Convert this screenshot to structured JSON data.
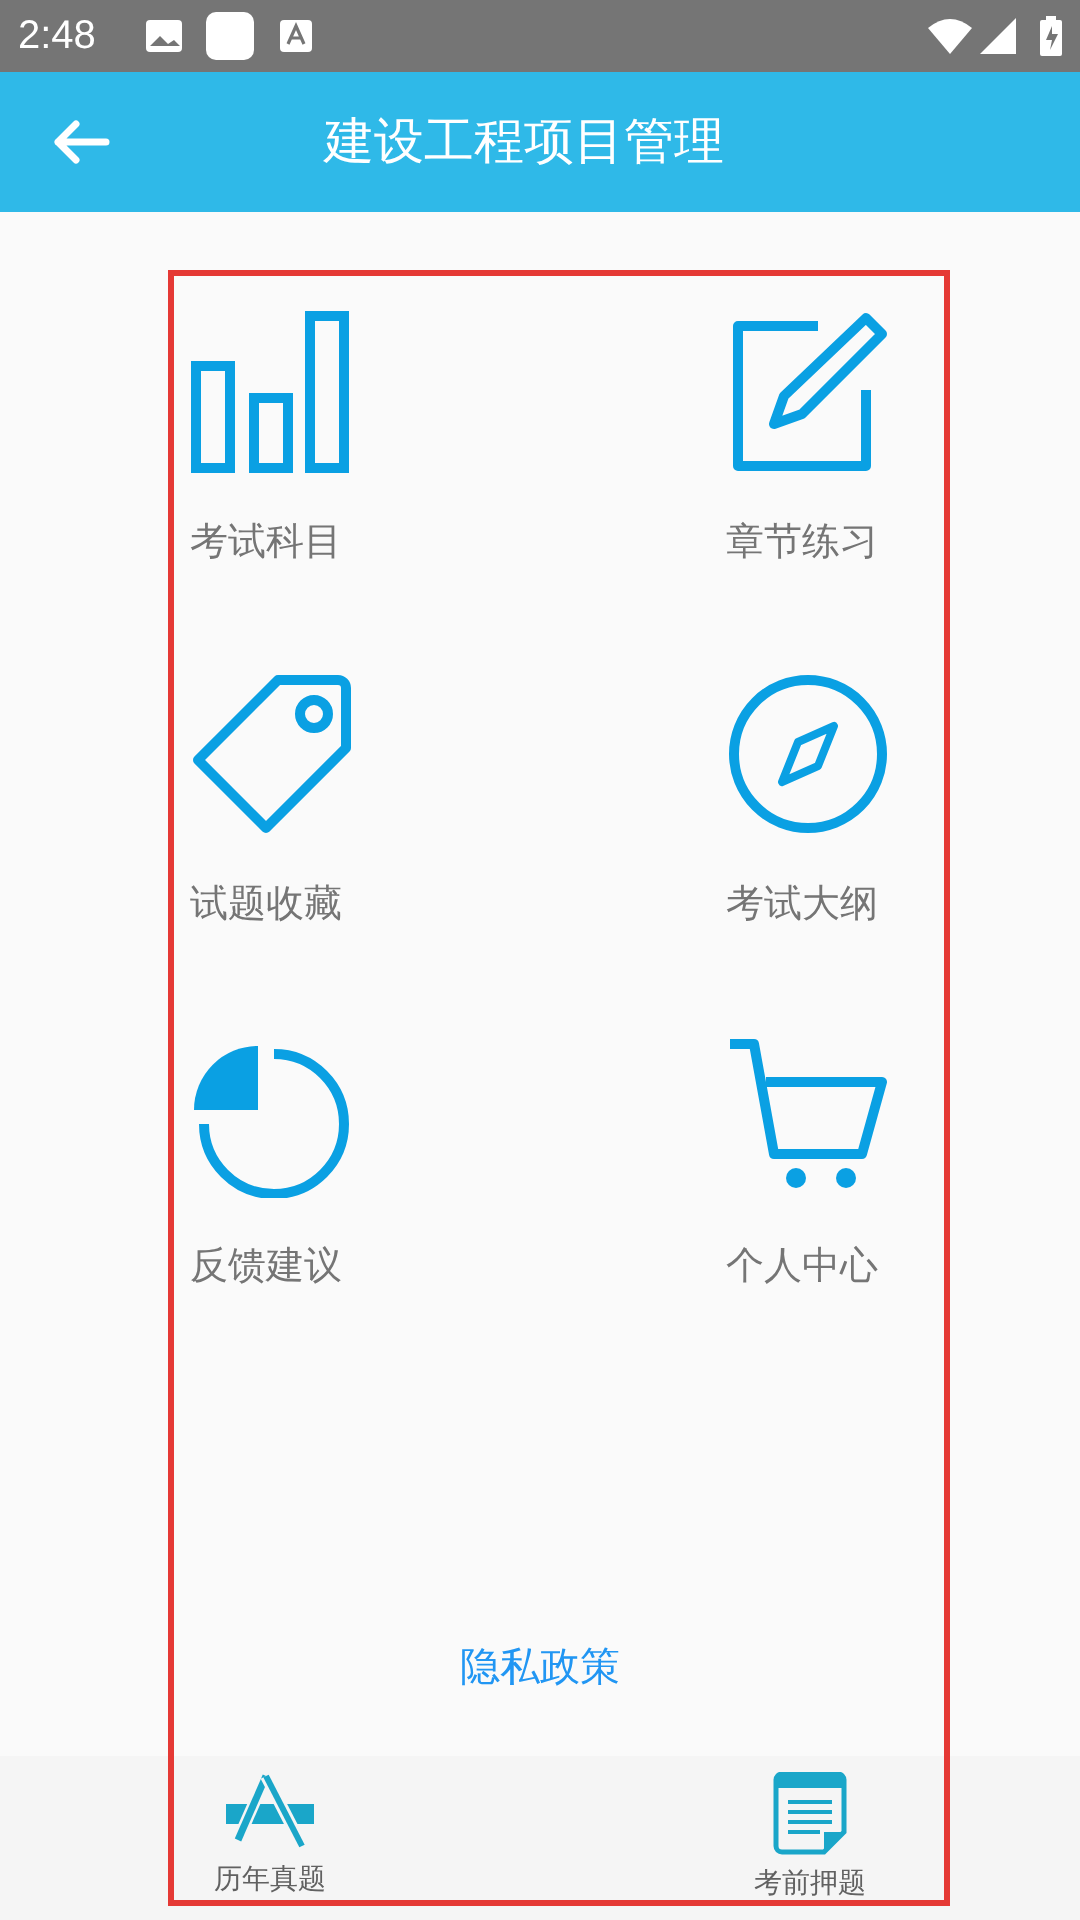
{
  "status_bar": {
    "time": "2:48"
  },
  "app_bar": {
    "title": "建设工程项目管理"
  },
  "menu": [
    {
      "label": "考试科目"
    },
    {
      "label": "章节练习"
    },
    {
      "label": "试题收藏"
    },
    {
      "label": "考试大纲"
    },
    {
      "label": "反馈建议"
    },
    {
      "label": "个人中心"
    }
  ],
  "privacy_link": "隐私政策",
  "bottom_nav": [
    {
      "label": "历年真题"
    },
    {
      "label": "考前押题"
    }
  ]
}
